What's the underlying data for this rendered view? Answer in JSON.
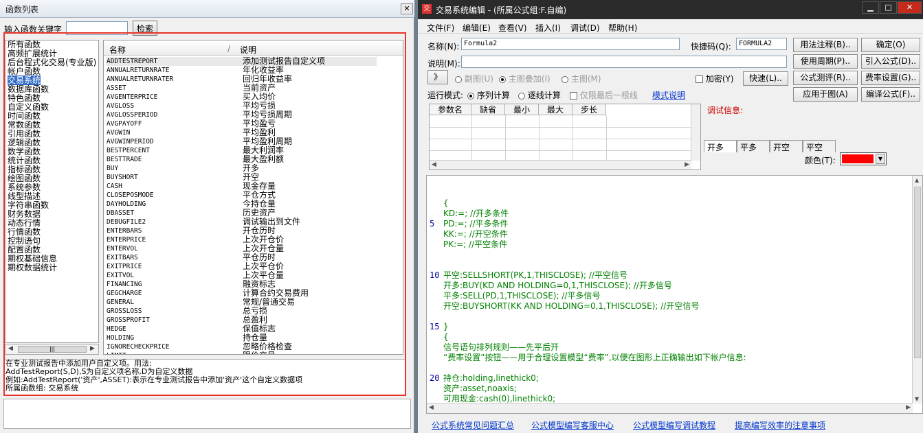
{
  "left_window": {
    "title": "函数列表",
    "search_label": "输入函数关键字",
    "search_value": "",
    "search_button": "检索",
    "categories": [
      "所有函数",
      "高频扩展统计",
      "后台程式化交易(专业版)",
      "帐户函数",
      "交易系统",
      "数据库函数",
      "特色函数",
      "自定义函数",
      "时间函数",
      "常数函数",
      "引用函数",
      "逻辑函数",
      "数学函数",
      "统计函数",
      "指标函数",
      "绘图函数",
      "系统参数",
      "线型描述",
      "字符串函数",
      "财务数据",
      "动态行情",
      "行情函数",
      "控制语句",
      "配置函数",
      "期权基础信息",
      "期权数据统计"
    ],
    "selected_category_index": 4,
    "columns": [
      "名称",
      "说明"
    ],
    "functions": [
      [
        "ADDTESTREPORT",
        "添加测试报告自定义项"
      ],
      [
        "ANNUALRETURNRATE",
        "年化收益率"
      ],
      [
        "ANNUALRETURNRATER",
        "回归年收益率"
      ],
      [
        "ASSET",
        "当前资产"
      ],
      [
        "AVGENTERPRICE",
        "买入均价"
      ],
      [
        "AVGLOSS",
        "平均亏损"
      ],
      [
        "AVGLOSSPERIOD",
        "平均亏损周期"
      ],
      [
        "AVGPAYOFF",
        "平均盈亏"
      ],
      [
        "AVGWIN",
        "平均盈利"
      ],
      [
        "AVGWINPERIOD",
        "平均盈利周期"
      ],
      [
        "BESTPERCENT",
        "最大利润率"
      ],
      [
        "BESTTRADE",
        "最大盈利额"
      ],
      [
        "BUY",
        "开多"
      ],
      [
        "BUYSHORT",
        "开空"
      ],
      [
        "CASH",
        "现金存量"
      ],
      [
        "CLOSEPOSMODE",
        "平仓方式"
      ],
      [
        "DAYHOLDING",
        "今持仓量"
      ],
      [
        "DBASSET",
        "历史资产"
      ],
      [
        "DEBUGFILE2",
        "调试输出到文件"
      ],
      [
        "ENTERBARS",
        "开仓历时"
      ],
      [
        "ENTERPRICE",
        "上次开仓价"
      ],
      [
        "ENTERVOL",
        "上次开仓量"
      ],
      [
        "EXITBARS",
        "平仓历时"
      ],
      [
        "EXITPRICE",
        "上次平仓价"
      ],
      [
        "EXITVOL",
        "上次平仓量"
      ],
      [
        "FINANCING",
        "融资标志"
      ],
      [
        "GEGCHARGE",
        "计算合约交易费用"
      ],
      [
        "GENERAL",
        "常规/普通交易"
      ],
      [
        "GROSSLOSS",
        "总亏损"
      ],
      [
        "GROSSPROFIT",
        "总盈利"
      ],
      [
        "HEDGE",
        "保值标志"
      ],
      [
        "HOLDING",
        "持仓量"
      ],
      [
        "IGNORECHECKPRICE",
        "忽略价格检查"
      ],
      [
        "LIMIT",
        "限价交易"
      ]
    ],
    "description_lines": [
      "在专业测试报告中添加用户自定义项。用法:",
      "AddTestReport(S,D),S为自定义项名称,D为自定义数据",
      "例如:AddTestReport('资产',ASSET):表示在专业测试报告中添加'资产'这个自定义数据项",
      "所属函数组: 交易系统"
    ]
  },
  "right_window": {
    "title": "交易系统编辑 - (所属公式组:F.自编)",
    "menu": [
      "文件(F)",
      "编辑(E)",
      "查看(V)",
      "插入(I)",
      "调试(D)",
      "帮助(H)"
    ],
    "name_label": "名称(N):",
    "name_value": "Formula2",
    "shortcut_label": "快捷码(Q):",
    "shortcut_value": "FORMULA2",
    "desc_label": "说明(M):",
    "desc_value": "",
    "btn_usage_note": "用法注释(B)..",
    "btn_confirm": "确定(O)",
    "btn_use_period": "使用周期(P)..",
    "btn_import": "引入公式(D)..",
    "btn_formula_test": "公式测评(R)..",
    "btn_fee_settings": "费率设置(G)..",
    "btn_apply_chart": "应用于图(A)",
    "btn_compile": "编译公式(F)..",
    "btn_expand": "》",
    "opt_subchart": "副图(U)",
    "opt_main_overlay": "主图叠加(I)",
    "opt_main": "主图(M)",
    "chk_encrypt": "加密(Y)",
    "btn_quick": "快速(L)..",
    "run_mode_label": "运行模式:",
    "run_seq": "序列计算",
    "run_tick": "逐线计算",
    "only_last": "仅限最后一根线",
    "mode_help": "模式说明",
    "param_headers": [
      "参数名",
      "缺省",
      "最小",
      "最大",
      "步长"
    ],
    "debug_label": "调试信息:",
    "tabs": [
      "开多",
      "平多",
      "开空",
      "平空"
    ],
    "color_label": "颜色(T):",
    "color_value": "#ff0000",
    "code_lines": [
      {
        "n": "",
        "t": ""
      },
      {
        "n": "",
        "t": ""
      },
      {
        "n": "",
        "t": "{"
      },
      {
        "n": "",
        "t": "KD:=;          //开多条件"
      },
      {
        "n": "5",
        "t": "PD:=;          //平多条件"
      },
      {
        "n": "",
        "t": "KK:=;          //开空条件"
      },
      {
        "n": "",
        "t": "PK:=;          //平空条件"
      },
      {
        "n": "",
        "t": ""
      },
      {
        "n": "",
        "t": ""
      },
      {
        "n": "10",
        "t": "平空:SELLSHORT(PK,1,THISCLOSE);                //平空信号"
      },
      {
        "n": "",
        "t": "开多:BUY(KD AND HOLDING=0,1,THISCLOSE);          //开多信号"
      },
      {
        "n": "",
        "t": "平多:SELL(PD,1,THISCLOSE);                      //平多信号"
      },
      {
        "n": "",
        "t": "开空:BUYSHORT(KK AND HOLDING=0,1,THISCLOSE);     //开空信号"
      },
      {
        "n": "",
        "t": ""
      },
      {
        "n": "15",
        "t": "}"
      },
      {
        "n": "",
        "t": "{"
      },
      {
        "n": "",
        "t": "信号语句排列规则——先平后开"
      },
      {
        "n": "",
        "t": "“费率设置”按钮——用于合理设置模型“费率”,以便在图形上正确输出如下帐户信息:"
      },
      {
        "n": "",
        "t": ""
      },
      {
        "n": "20",
        "t": "持仓:holding,linethick0;"
      },
      {
        "n": "",
        "t": "资产:asset,noaxis;"
      },
      {
        "n": "",
        "t": "可用现金:cash(0),linethick0;"
      }
    ],
    "bottom_links": [
      "公式系统常见问题汇总",
      "公式模型编写客服中心",
      "公式模型编写调试教程",
      "提高编写效率的注意事项"
    ]
  }
}
